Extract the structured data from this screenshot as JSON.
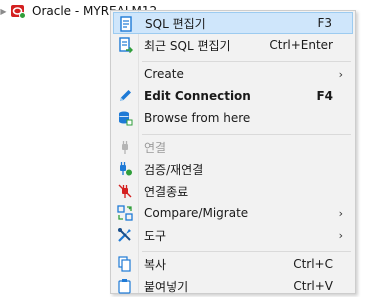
{
  "tree": {
    "node_label": "Oracle - MYREALM12"
  },
  "menu": {
    "items": [
      {
        "label": "SQL 편집기",
        "shortcut": "F3"
      },
      {
        "label": "최근 SQL 편집기",
        "shortcut": "Ctrl+Enter"
      },
      {
        "label": "Create"
      },
      {
        "label": "Edit Connection",
        "shortcut": "F4"
      },
      {
        "label": "Browse from here"
      },
      {
        "label": "연결"
      },
      {
        "label": "검증/재연결"
      },
      {
        "label": "연결종료"
      },
      {
        "label": "Compare/Migrate"
      },
      {
        "label": "도구"
      },
      {
        "label": "복사",
        "shortcut": "Ctrl+C"
      },
      {
        "label": "붙여넣기",
        "shortcut": "Ctrl+V"
      }
    ],
    "submenu_arrow": "›"
  },
  "colors": {
    "selection_bg": "#cfe6fb",
    "accent_blue": "#1e7ad6",
    "oracle_red": "#d42020",
    "green": "#2f9e3a"
  }
}
